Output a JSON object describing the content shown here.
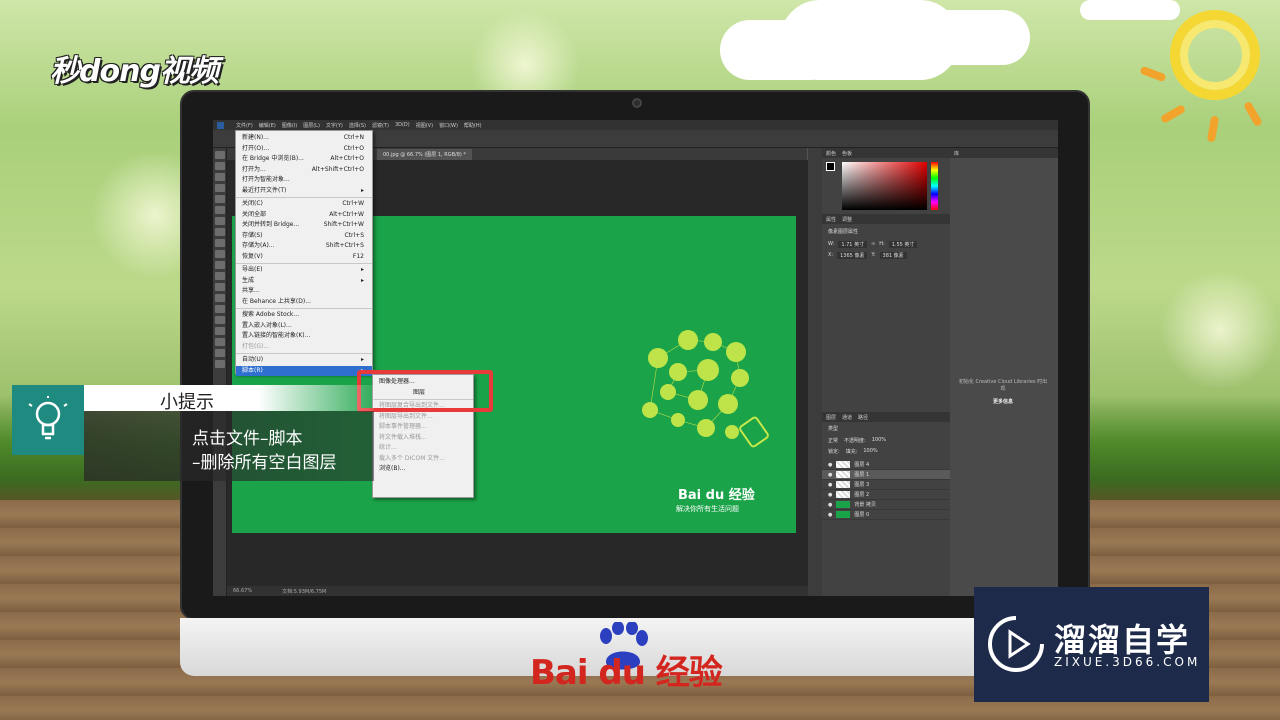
{
  "brand_top": "秒dong视频",
  "tip": {
    "title": "小提示",
    "line1": "点击文件–脚本",
    "line2": "–删除所有空白图层"
  },
  "photoshop": {
    "menubar": [
      "文件(F)",
      "编辑(E)",
      "图像(I)",
      "图层(L)",
      "文字(Y)",
      "选择(S)",
      "滤镜(T)",
      "3D(D)",
      "视图(V)",
      "窗口(W)",
      "帮助(H)"
    ],
    "doc_tab": "00.jpg @ 66.7% (图层 1, RGB/8) *",
    "status_zoom": "66.67%",
    "status_doc": "文档:5.93M/6.75M",
    "panels": {
      "color_tabs": [
        "颜色",
        "色板"
      ],
      "properties_tabs": [
        "属性",
        "调整"
      ],
      "properties_title": "像素图层属性",
      "w_label": "W:",
      "w_value": "1.71 英寸",
      "h_label": "H:",
      "h_value": "1.55 英寸",
      "x_label": "X:",
      "x_value": "1365 像素",
      "y_label": "Y:",
      "y_value": "381 像素",
      "layers_tabs": [
        "图层",
        "通道",
        "路径"
      ],
      "kind": "类型",
      "blend": "正常",
      "opacity_label": "不透明度:",
      "opacity": "100%",
      "lock_label": "锁定:",
      "fill_label": "填充:",
      "fill": "100%",
      "layers": [
        "图层 4",
        "图层 1",
        "图层 3",
        "图层 2",
        "背景 拷贝",
        "图层 0"
      ],
      "library_tab": "库",
      "library_msg": "初始化 Creative Cloud Libraries 时出现",
      "library_more": "更多信息"
    },
    "document": {
      "brand": "Bai du 经验",
      "tagline": "解决你所有生活问题"
    },
    "file_menu": [
      {
        "label": "新建(N)...",
        "shortcut": "Ctrl+N"
      },
      {
        "label": "打开(O)...",
        "shortcut": "Ctrl+O"
      },
      {
        "label": "在 Bridge 中浏览(B)...",
        "shortcut": "Alt+Ctrl+O"
      },
      {
        "label": "打开为...",
        "shortcut": "Alt+Shift+Ctrl+O"
      },
      {
        "label": "打开为智能对象...",
        "shortcut": ""
      },
      {
        "label": "最近打开文件(T)",
        "shortcut": "▸"
      },
      {
        "sep": true
      },
      {
        "label": "关闭(C)",
        "shortcut": "Ctrl+W"
      },
      {
        "label": "关闭全部",
        "shortcut": "Alt+Ctrl+W"
      },
      {
        "label": "关闭并转到 Bridge...",
        "shortcut": "Shift+Ctrl+W"
      },
      {
        "label": "存储(S)",
        "shortcut": "Ctrl+S"
      },
      {
        "label": "存储为(A)...",
        "shortcut": "Shift+Ctrl+S"
      },
      {
        "label": "恢复(V)",
        "shortcut": "F12"
      },
      {
        "sep": true
      },
      {
        "label": "导出(E)",
        "shortcut": "▸"
      },
      {
        "label": "生成",
        "shortcut": "▸"
      },
      {
        "label": "共享...",
        "shortcut": ""
      },
      {
        "label": "在 Behance 上共享(D)...",
        "shortcut": ""
      },
      {
        "sep": true
      },
      {
        "label": "搜索 Adobe Stock...",
        "shortcut": ""
      },
      {
        "label": "置入嵌入对象(L)...",
        "shortcut": ""
      },
      {
        "label": "置入链接的智能对象(K)...",
        "shortcut": ""
      },
      {
        "label": "打包(G)...",
        "shortcut": "",
        "disabled": true
      },
      {
        "sep": true
      },
      {
        "label": "自动(U)",
        "shortcut": "▸"
      },
      {
        "label": "脚本(R)",
        "shortcut": "▸",
        "highlight": true
      }
    ],
    "script_submenu": [
      {
        "label": "图像处理器..."
      },
      {
        "label": "图层"
      },
      {
        "sep": true
      },
      {
        "label": "将图层复合导出到文件...",
        "disabled": true
      },
      {
        "label": "将图层导出到文件...",
        "disabled": true
      },
      {
        "label": "脚本事件管理器...",
        "disabled": true
      },
      {
        "label": "将文件载入堆栈...",
        "disabled": true
      },
      {
        "label": "统计...",
        "disabled": true
      },
      {
        "label": "载入多个 DICOM 文件...",
        "disabled": true
      },
      {
        "label": "浏览(B)..."
      }
    ]
  },
  "baidu_chin": "Bai du 经验",
  "zixue": {
    "name": "溜溜自学",
    "url": "ZIXUE.3D66.COM"
  }
}
